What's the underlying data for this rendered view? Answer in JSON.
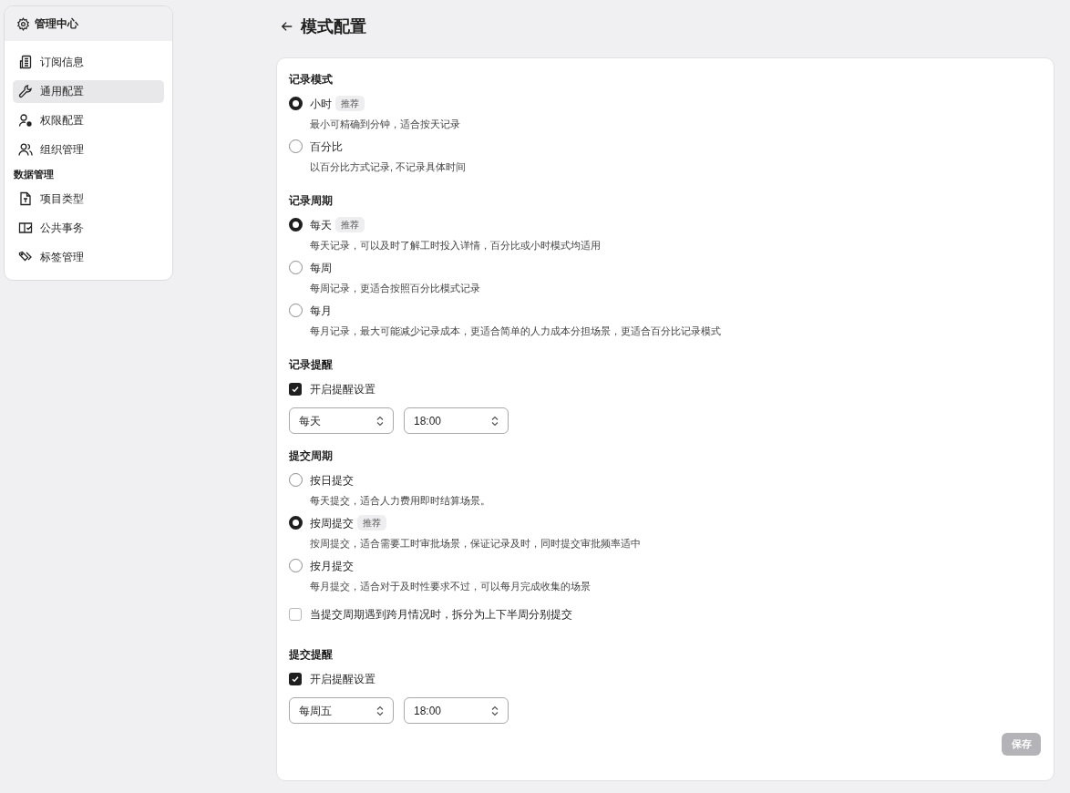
{
  "sidebar": {
    "title": "管理中心",
    "items": [
      {
        "kind": "item",
        "label": "订阅信息",
        "selected": false
      },
      {
        "kind": "item",
        "label": "通用配置",
        "selected": true
      },
      {
        "kind": "item",
        "label": "权限配置",
        "selected": false
      },
      {
        "kind": "item",
        "label": "组织管理",
        "selected": false
      },
      {
        "kind": "heading",
        "label": "数据管理"
      },
      {
        "kind": "item",
        "label": "项目类型",
        "selected": false
      },
      {
        "kind": "item",
        "label": "公共事务",
        "selected": false
      },
      {
        "kind": "item",
        "label": "标签管理",
        "selected": false
      }
    ]
  },
  "page": {
    "title": "模式配置"
  },
  "sections": [
    {
      "heading": "记录模式",
      "items": [
        {
          "kind": "radio",
          "label": "小时",
          "badge": "推荐",
          "description": "最小可精确到分钟，适合按天记录",
          "selected": true
        },
        {
          "kind": "radio",
          "label": "百分比",
          "description": "以百分比方式记录, 不记录具体时间",
          "selected": false
        }
      ]
    },
    {
      "heading": "记录周期",
      "items": [
        {
          "kind": "radio",
          "label": "每天",
          "badge": "推荐",
          "description": "每天记录，可以及时了解工时投入详情，百分比或小时模式均适用",
          "selected": true
        },
        {
          "kind": "radio",
          "label": "每周",
          "description": "每周记录，更适合按照百分比模式记录",
          "selected": false
        },
        {
          "kind": "radio",
          "label": "每月",
          "description": "每月记录，最大可能减少记录成本，更适合简单的人力成本分担场景，更适合百分比记录模式",
          "selected": false
        }
      ]
    },
    {
      "heading": "记录提醒",
      "items": [
        {
          "kind": "checkbox",
          "label": "开启提醒设置",
          "checked": true
        },
        {
          "kind": "selects",
          "selects": [
            {
              "value": "每天"
            },
            {
              "value": "18:00"
            }
          ]
        }
      ]
    },
    {
      "heading": "提交周期",
      "items": [
        {
          "kind": "radio",
          "label": "按日提交",
          "description": "每天提交，适合人力费用即时结算场景。",
          "selected": false
        },
        {
          "kind": "radio",
          "label": "按周提交",
          "badge": "推荐",
          "description": "按周提交，适合需要工时审批场景，保证记录及时，同时提交审批频率适中",
          "selected": true
        },
        {
          "kind": "radio",
          "label": "按月提交",
          "description": "每月提交，适合对于及时性要求不过，可以每月完成收集的场景",
          "selected": false
        },
        {
          "kind": "checkbox",
          "label": "当提交周期遇到跨月情况时，拆分为上下半周分别提交",
          "checked": false
        }
      ]
    },
    {
      "heading": "提交提醒",
      "items": [
        {
          "kind": "checkbox",
          "label": "开启提醒设置",
          "checked": true
        },
        {
          "kind": "selects",
          "selects": [
            {
              "value": "每周五"
            },
            {
              "value": "18:00"
            }
          ]
        }
      ]
    }
  ],
  "save_button": {
    "label": "保存",
    "disabled": true
  }
}
